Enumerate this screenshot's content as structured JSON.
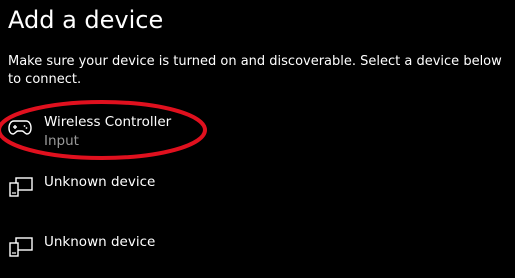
{
  "dialog": {
    "title": "Add a device",
    "description": "Make sure your device is turned on and discoverable. Select a device below to connect."
  },
  "devices": [
    {
      "name": "Wireless Controller",
      "type": "Input",
      "icon": "gamepad-icon"
    },
    {
      "name": "Unknown device",
      "icon": "device-icon"
    },
    {
      "name": "Unknown device",
      "icon": "device-icon"
    }
  ],
  "annotation": {
    "color": "#e0101e"
  }
}
